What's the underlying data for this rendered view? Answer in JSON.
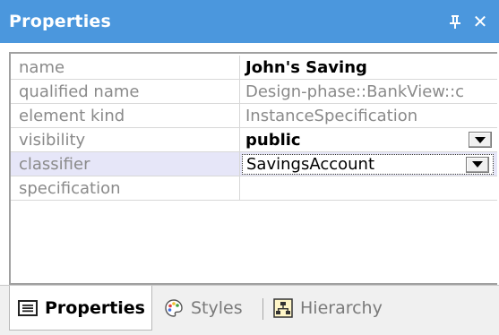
{
  "window": {
    "title": "Properties",
    "pin_icon": "pin-icon",
    "close_glyph": "✕"
  },
  "properties": [
    {
      "name": "name",
      "value": "John's Saving",
      "style": "bold"
    },
    {
      "name": "qualified name",
      "value": "Design-phase::BankView::c",
      "style": "readonly"
    },
    {
      "name": "element kind",
      "value": "InstanceSpecification",
      "style": "readonly"
    },
    {
      "name": "visibility",
      "value": "public",
      "style": "bold",
      "dropdown": true
    },
    {
      "name": "classifier",
      "value": "SavingsAccount",
      "style": "normal",
      "dropdown": true,
      "selected": true
    },
    {
      "name": "specification",
      "value": "",
      "style": "normal"
    }
  ],
  "tabs": [
    {
      "label": "Properties",
      "icon": "properties-list-icon",
      "active": true
    },
    {
      "label": "Styles",
      "icon": "palette-icon",
      "active": false
    },
    {
      "label": "Hierarchy",
      "icon": "hierarchy-icon",
      "active": false
    }
  ],
  "colors": {
    "titlebar": "#4b97dd",
    "selected_row": "#e6e6f8",
    "label_gray": "#8a8a8a"
  }
}
